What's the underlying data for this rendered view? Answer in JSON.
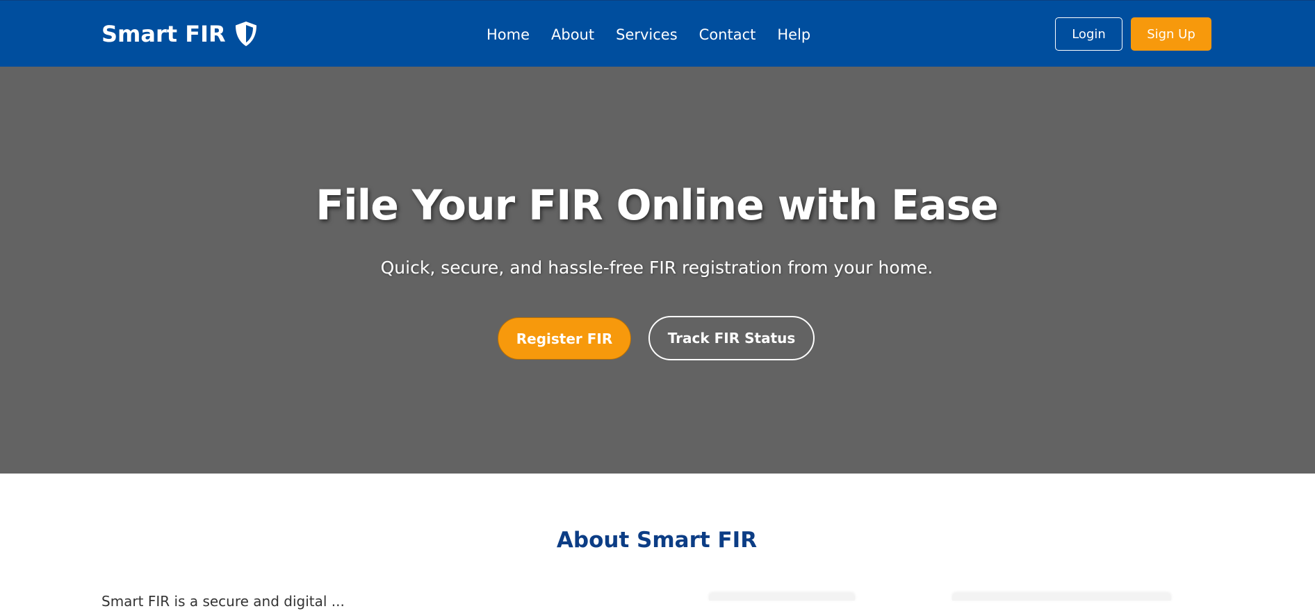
{
  "header": {
    "brand": "Smart FIR",
    "brand_icon": "shield-icon",
    "nav": [
      {
        "label": "Home"
      },
      {
        "label": "About"
      },
      {
        "label": "Services"
      },
      {
        "label": "Contact"
      },
      {
        "label": "Help"
      }
    ],
    "login_label": "Login",
    "signup_label": "Sign Up"
  },
  "hero": {
    "title": "File Your FIR Online with Ease",
    "subtitle": "Quick, secure, and hassle-free FIR registration from your home.",
    "register_label": "Register FIR",
    "track_label": "Track FIR Status"
  },
  "about": {
    "title": "About Smart FIR",
    "text": "Smart FIR is a secure and digital ..."
  },
  "colors": {
    "navbar": "#004e9e",
    "accent": "#f7990c",
    "hero_bg": "#636363",
    "heading": "#0c3d85"
  }
}
